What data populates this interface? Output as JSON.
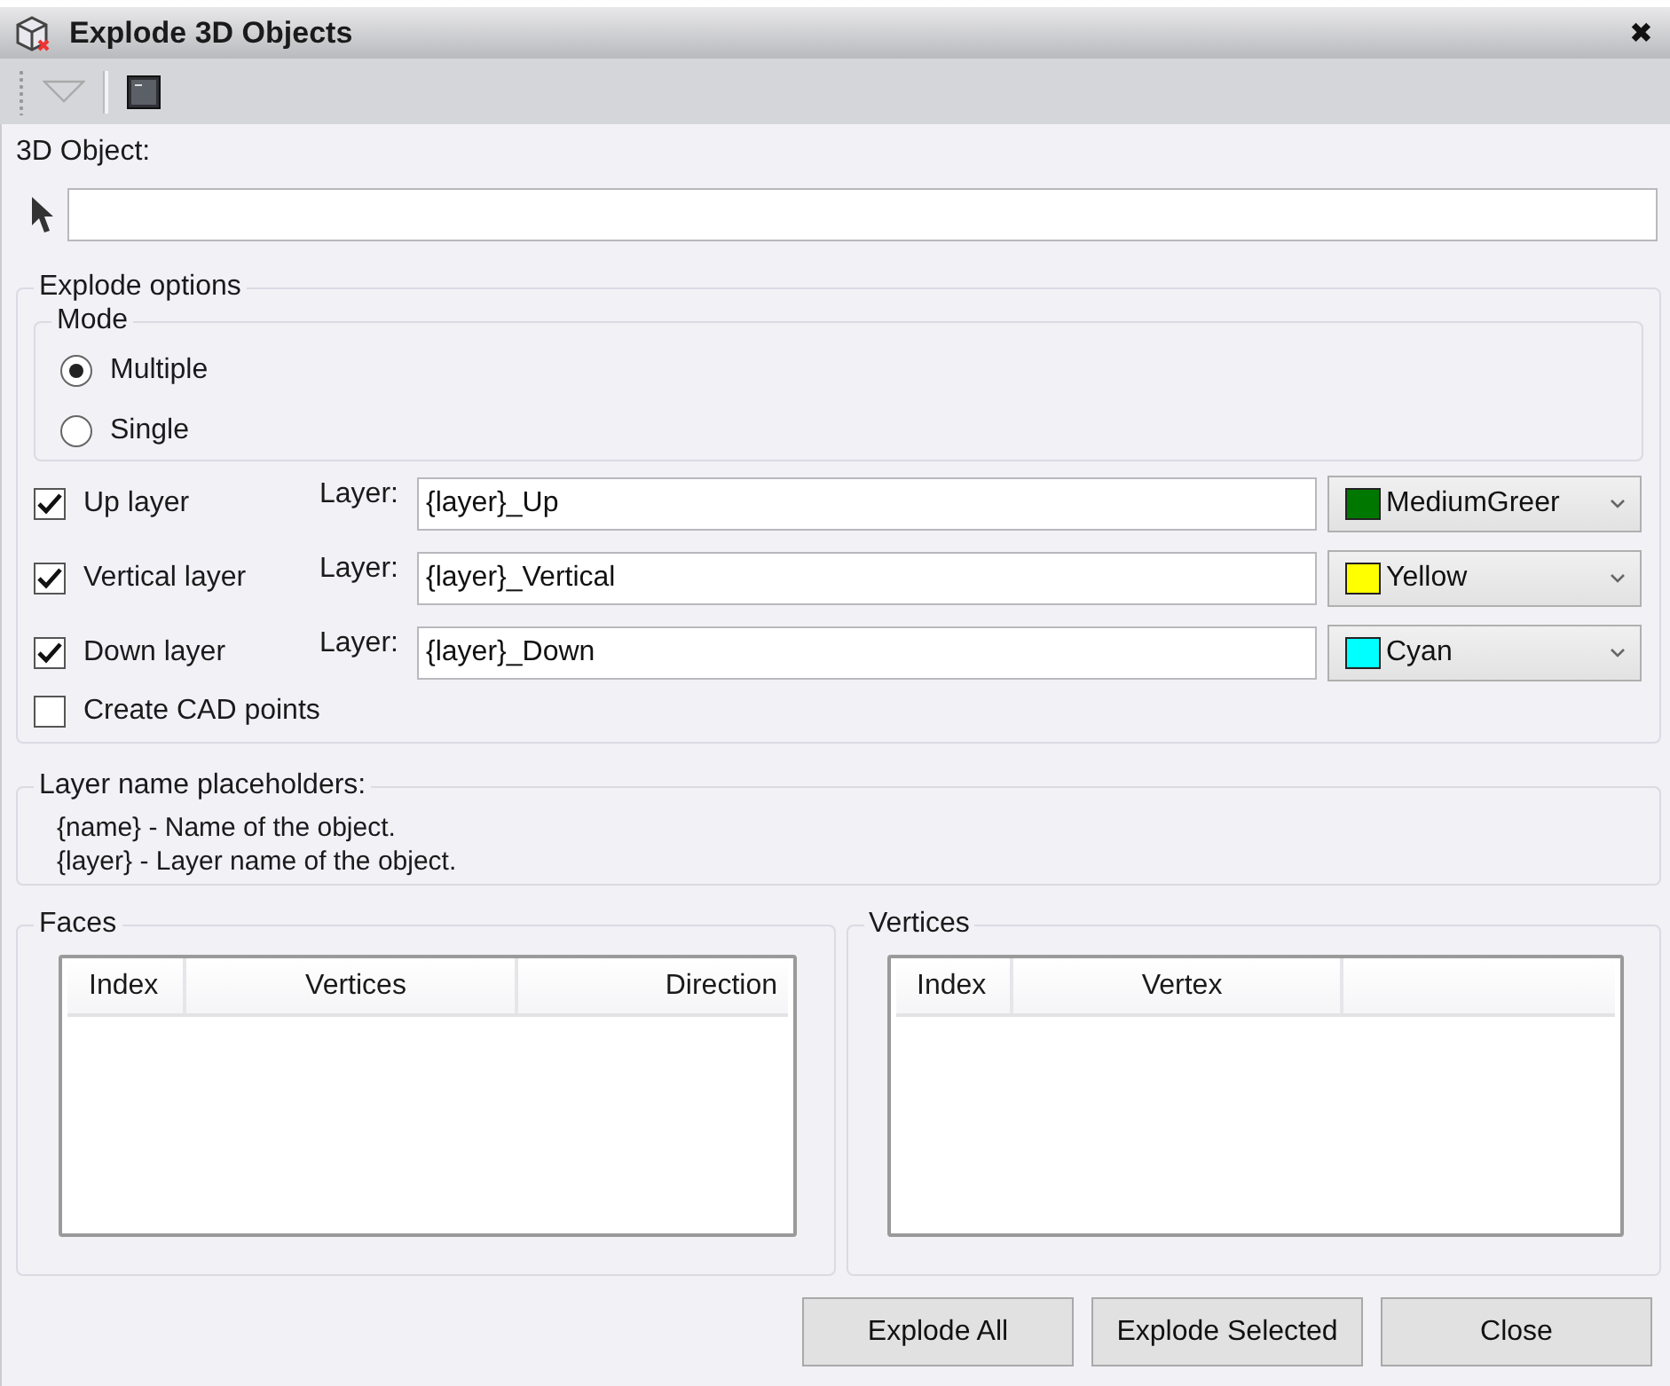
{
  "window": {
    "title": "Explode 3D Objects",
    "close": "✖"
  },
  "object_field": {
    "label": "3D Object:"
  },
  "explode_options": {
    "title": "Explode options",
    "mode": {
      "title": "Mode",
      "options": [
        {
          "label": "Multiple",
          "selected": true
        },
        {
          "label": "Single",
          "selected": false
        }
      ]
    },
    "layers": [
      {
        "label": "Up layer",
        "checked": true,
        "field_label": "Layer:",
        "value": "{layer}_Up",
        "color_name": "MediumGreer",
        "color": "#007800"
      },
      {
        "label": "Vertical layer",
        "checked": true,
        "field_label": "Layer:",
        "value": "{layer}_Vertical",
        "color_name": "Yellow",
        "color": "#ffff00"
      },
      {
        "label": "Down layer",
        "checked": true,
        "field_label": "Layer:",
        "value": "{layer}_Down",
        "color_name": "Cyan",
        "color": "#00ffff"
      }
    ],
    "create_cad_points": {
      "label": "Create CAD points",
      "checked": false
    }
  },
  "placeholders": {
    "title": "Layer name placeholders:",
    "lines": [
      "{name} - Name of the object.",
      "{layer} - Layer name of the object."
    ]
  },
  "faces": {
    "title": "Faces",
    "columns": [
      "Index",
      "Vertices",
      "Direction"
    ]
  },
  "vertices": {
    "title": "Vertices",
    "columns": [
      "Index",
      "Vertex"
    ]
  },
  "buttons": [
    "Explode All",
    "Explode Selected",
    "Close"
  ]
}
